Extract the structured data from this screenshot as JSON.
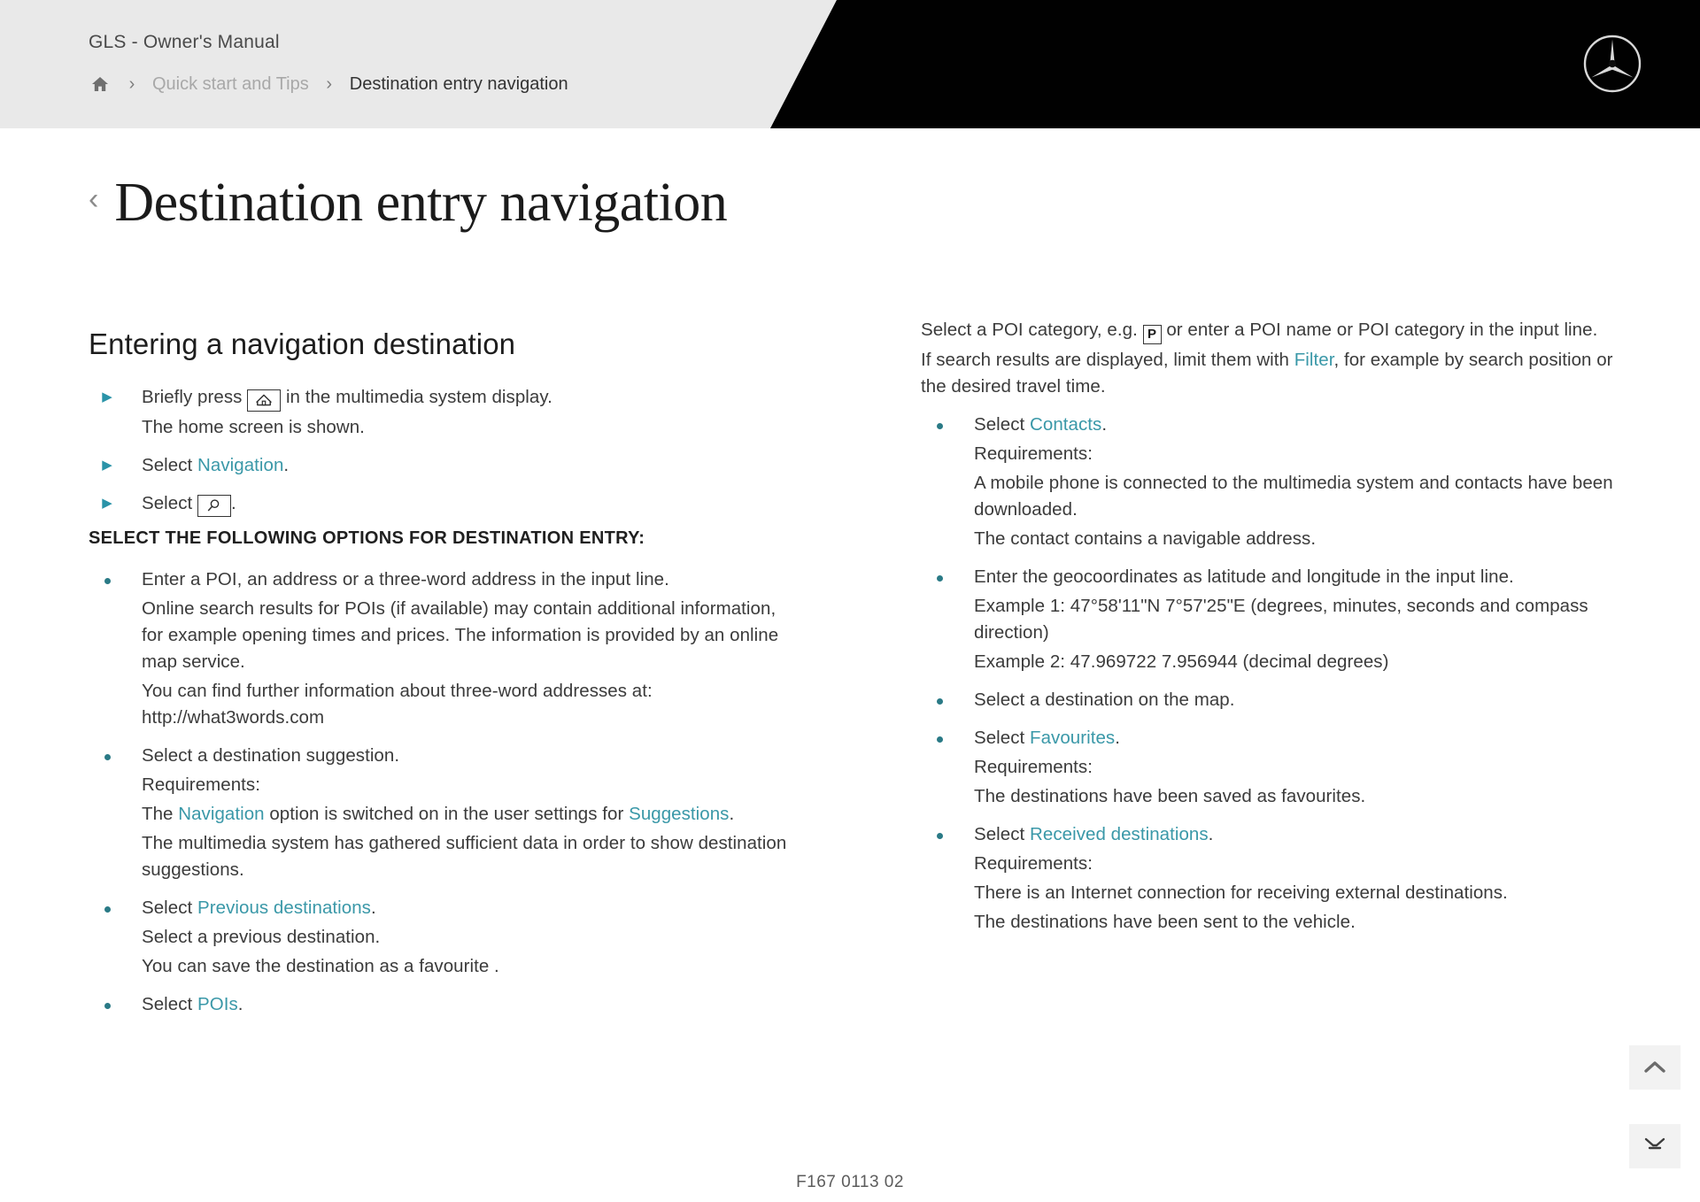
{
  "header": {
    "brand_title": "GLS - Owner's Manual",
    "breadcrumb": {
      "home_icon": "home-icon",
      "separator": "›",
      "parent": "Quick start and Tips",
      "current": "Destination entry navigation"
    },
    "logo": "mercedes-benz-star-logo"
  },
  "page": {
    "back_chevron": "‹",
    "title": "Destination entry navigation"
  },
  "left_column": {
    "heading": "Entering a navigation destination",
    "step1": {
      "before_icon": "Briefly press",
      "icon": "home-icon",
      "after_icon": "in the multimedia system display.",
      "result": "The home screen is shown."
    },
    "step2": {
      "prefix": "Select",
      "link": "Navigation",
      "suffix": "."
    },
    "step3": {
      "prefix": "Select",
      "icon": "search-icon",
      "suffix": "."
    },
    "options_heading": "SELECT THE FOLLOWING OPTIONS FOR DESTINATION ENTRY:",
    "bullets": [
      {
        "lines": [
          "Enter a POI, an address or a three-word address in the input line.",
          "Online search results for POIs (if available) may contain additional information, for example opening times and prices. The information is provided by an online map service.",
          "You can find further information about three-word addresses at: http://what3words.com"
        ]
      },
      {
        "lines": [
          "Select a destination suggestion.",
          "Requirements:",
          "The multimedia system has gathered sufficient data in order to show destination suggestions."
        ],
        "req_line_prefix": "The ",
        "req_link_1": "Navigation",
        "req_line_middle": " option is switched on in the user settings for ",
        "req_link_2": "Suggestions",
        "req_line_suffix": "."
      },
      {
        "prefix": "Select",
        "link": "Previous destinations",
        "suffix": ".",
        "lines": [
          "Select a previous destination.",
          "You can save the destination as a favourite ."
        ]
      },
      {
        "prefix": "Select",
        "link": "POIs",
        "suffix": "."
      }
    ]
  },
  "right_column": {
    "poi_line_1_a": "Select a POI category, e.g.",
    "poi_icon": "parking-icon",
    "poi_icon_letter": "P",
    "poi_line_1_b": "or enter a POI name or POI category in the input line.",
    "filter_line_a": "If search results are displayed, limit them with ",
    "filter_link": "Filter",
    "filter_line_b": ", for example by search position or the desired travel time.",
    "bullets": [
      {
        "prefix": "Select",
        "link": "Contacts",
        "suffix": ".",
        "lines": [
          "Requirements:",
          "A mobile phone is connected to the multimedia system and contacts have been downloaded.",
          "The contact contains a navigable address."
        ]
      },
      {
        "lines": [
          "Enter the geocoordinates as latitude and longitude in the input line.",
          "Example 1: 47°58'11\"N 7°57'25\"E (degrees, minutes, seconds and compass direction)",
          "Example 2: 47.969722 7.956944 (decimal degrees)"
        ]
      },
      {
        "lines": [
          "Select a destination on the map."
        ]
      },
      {
        "prefix": "Select",
        "link": "Favourites",
        "suffix": ".",
        "lines": [
          "Requirements:",
          "The destinations have been saved as favourites."
        ]
      },
      {
        "prefix": "Select",
        "link": "Received destinations",
        "suffix": ".",
        "lines": [
          "Requirements:",
          "There is an Internet connection for receiving external destinations.",
          "The destinations have been sent to the vehicle."
        ]
      }
    ]
  },
  "floating_buttons": {
    "scroll_top": "scroll-to-top-icon",
    "collapse": "collapse-icon"
  },
  "footer": {
    "document_code": "F167 0113 02"
  },
  "colors": {
    "header_bg": "#e9e9e9",
    "header_black": "#010101",
    "teal_link": "#3a98a8",
    "bullet_teal": "#2a7a86",
    "body_text": "#3b3b3b"
  }
}
